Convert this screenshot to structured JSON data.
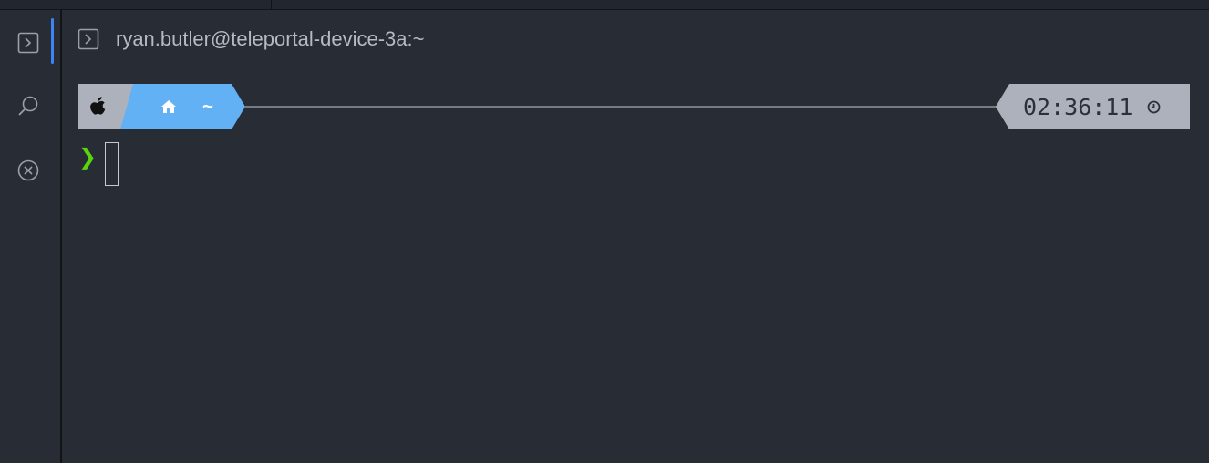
{
  "window": {
    "title": "ryan.butler@teleportal-device-3a:~"
  },
  "sidebar": {
    "items": [
      {
        "name": "terminal",
        "icon": "terminal-icon",
        "active": true
      },
      {
        "name": "search",
        "icon": "search-icon",
        "active": false
      },
      {
        "name": "close",
        "icon": "close-circle-icon",
        "active": false
      }
    ]
  },
  "prompt": {
    "os_icon": "apple-icon",
    "home_icon": "home-icon",
    "directory": "~",
    "time": "02:36:11",
    "time_icon": "clock-icon",
    "input_marker": "❯",
    "command": ""
  },
  "colors": {
    "background": "#282c35",
    "accent": "#3d84f7",
    "segment_gray": "#acb1bc",
    "segment_blue": "#62b1f5",
    "prompt_green": "#5bd30d"
  }
}
